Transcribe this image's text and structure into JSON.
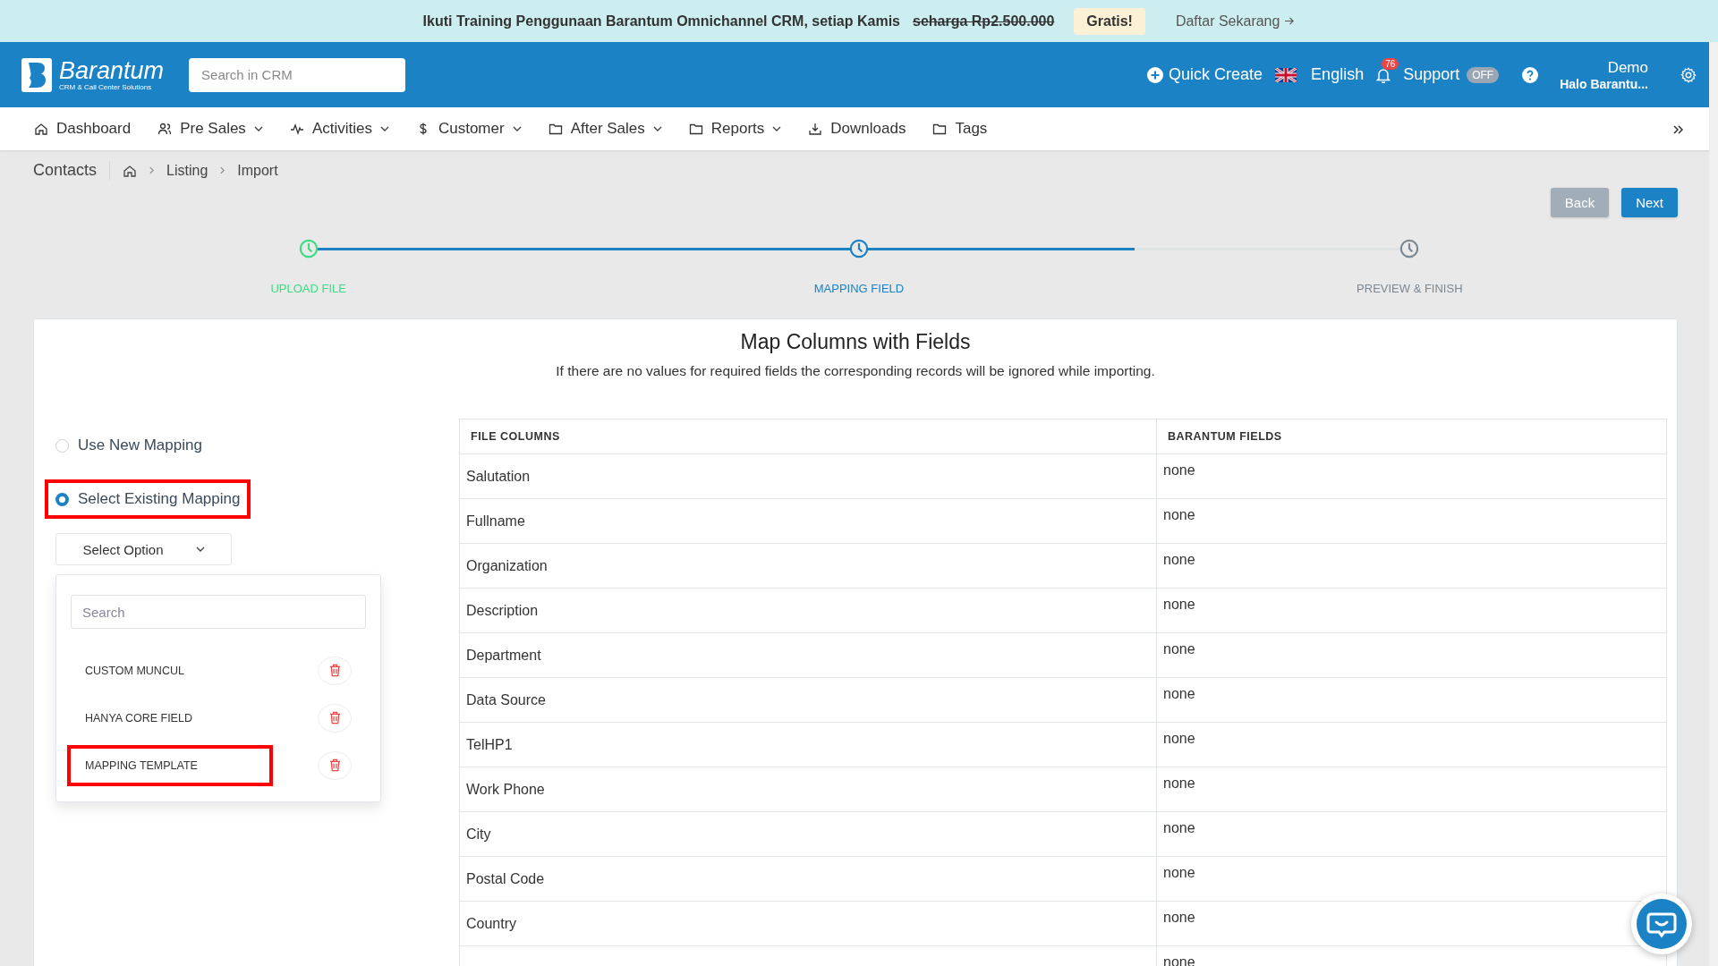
{
  "promo_banner": {
    "text": "Ikuti Training Penggunaan Barantum Omnichannel CRM, setiap Kamis",
    "old_price": "seharga Rp2.500.000",
    "badge": "Gratis!",
    "link": "Daftar Sekarang"
  },
  "header": {
    "logo_name": "Barantum",
    "logo_tagline": "CRM & Call Center Solutions",
    "search": {
      "placeholder": "Search in CRM"
    },
    "quick_create": "Quick Create",
    "language": "English",
    "notification_count": "76",
    "support": "Support",
    "support_toggle": {
      "label": "OFF",
      "on": false
    },
    "user_name": "Demo",
    "user_greeting": "Halo Barantu..."
  },
  "nav": [
    {
      "label": "Dashboard",
      "kind": "home",
      "dropdown": false
    },
    {
      "label": "Pre Sales",
      "kind": "users",
      "dropdown": true
    },
    {
      "label": "Activities",
      "kind": "pulse",
      "dropdown": true
    },
    {
      "label": "Customer",
      "kind": "dollar",
      "dropdown": true
    },
    {
      "label": "After Sales",
      "kind": "folder",
      "dropdown": true
    },
    {
      "label": "Reports",
      "kind": "folder",
      "dropdown": true
    },
    {
      "label": "Downloads",
      "kind": "download",
      "dropdown": false
    },
    {
      "label": "Tags",
      "kind": "folder",
      "dropdown": false
    }
  ],
  "breadcrumb": {
    "title": "Contacts",
    "items": [
      "Listing",
      "Import"
    ]
  },
  "buttons": [
    {
      "label": "Back",
      "kind": "secondary"
    },
    {
      "label": "Next",
      "kind": "primary"
    }
  ],
  "steps": [
    {
      "label": "UPLOAD FILE",
      "kind": "done"
    },
    {
      "label": "MAPPING FIELD",
      "kind": "active"
    },
    {
      "label": "PREVIEW & FINISH",
      "kind": "pending"
    }
  ],
  "card": {
    "title": "Map Columns with Fields",
    "subtitle": "If there are no values for required fields the corresponding records will be ignored while importing."
  },
  "mapping_options": [
    {
      "label": "Use New Mapping",
      "selected": false,
      "highlighted": false
    },
    {
      "label": "Select Existing Mapping",
      "selected": true,
      "highlighted": true
    }
  ],
  "mapping_select": {
    "placeholder": "Select Option",
    "search": {
      "placeholder": "Search"
    },
    "items": [
      {
        "label": "CUSTOM MUNCUL",
        "highlighted": false
      },
      {
        "label": "HANYA CORE FIELD",
        "highlighted": false
      },
      {
        "label": "MAPPING TEMPLATE",
        "highlighted": true
      }
    ]
  },
  "table": {
    "columns": [
      "FILE COLUMNS",
      "BARANTUM FIELDS"
    ],
    "rows": [
      {
        "column": "Salutation",
        "field": "none"
      },
      {
        "column": "Fullname",
        "field": "none"
      },
      {
        "column": "Organization",
        "field": "none"
      },
      {
        "column": "Description",
        "field": "none"
      },
      {
        "column": "Department",
        "field": "none"
      },
      {
        "column": "Data Source",
        "field": "none"
      },
      {
        "column": "TelHP1",
        "field": "none"
      },
      {
        "column": "Work Phone",
        "field": "none"
      },
      {
        "column": "City",
        "field": "none"
      },
      {
        "column": "Postal Code",
        "field": "none"
      },
      {
        "column": "Country",
        "field": "none"
      },
      {
        "field": "none"
      }
    ]
  }
}
